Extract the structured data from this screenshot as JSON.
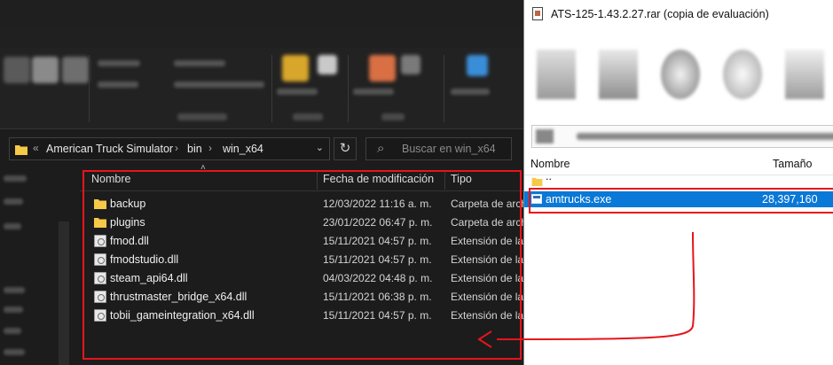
{
  "explorer": {
    "address": {
      "crumbs": [
        "American Truck Simulator",
        "bin",
        "win_x64"
      ]
    },
    "search_placeholder": "Buscar en win_x64",
    "columns": {
      "name": "Nombre",
      "date": "Fecha de modificación",
      "type": "Tipo"
    },
    "files": [
      {
        "name": "backup",
        "date": "12/03/2022 11:16 a. m.",
        "type": "Carpeta de arch",
        "kind": "folder"
      },
      {
        "name": "plugins",
        "date": "23/01/2022 06:47 p. m.",
        "type": "Carpeta de arch",
        "kind": "folder"
      },
      {
        "name": "fmod.dll",
        "date": "15/11/2021 04:57 p. m.",
        "type": "Extensión de la",
        "kind": "dll"
      },
      {
        "name": "fmodstudio.dll",
        "date": "15/11/2021 04:57 p. m.",
        "type": "Extensión de la",
        "kind": "dll"
      },
      {
        "name": "steam_api64.dll",
        "date": "04/03/2022 04:48 p. m.",
        "type": "Extensión de la",
        "kind": "dll"
      },
      {
        "name": "thrustmaster_bridge_x64.dll",
        "date": "15/11/2021 06:38 p. m.",
        "type": "Extensión de la",
        "kind": "dll"
      },
      {
        "name": "tobii_gameintegration_x64.dll",
        "date": "15/11/2021 04:57 p. m.",
        "type": "Extensión de la",
        "kind": "dll"
      }
    ],
    "colors": {
      "folder": "#f7c948",
      "highlight": "#e8141b"
    }
  },
  "winrar": {
    "title": "ATS-125-1.43.2.27.rar (copia de evaluación)",
    "columns": {
      "name": "Nombre",
      "size": "Tamaño"
    },
    "rows": [
      {
        "name": "..",
        "size": "",
        "kind": "folder"
      },
      {
        "name": "amtrucks.exe",
        "size": "28,397,160",
        "kind": "exe",
        "selected": true
      }
    ],
    "colors": {
      "selection": "#0a78d6"
    }
  }
}
